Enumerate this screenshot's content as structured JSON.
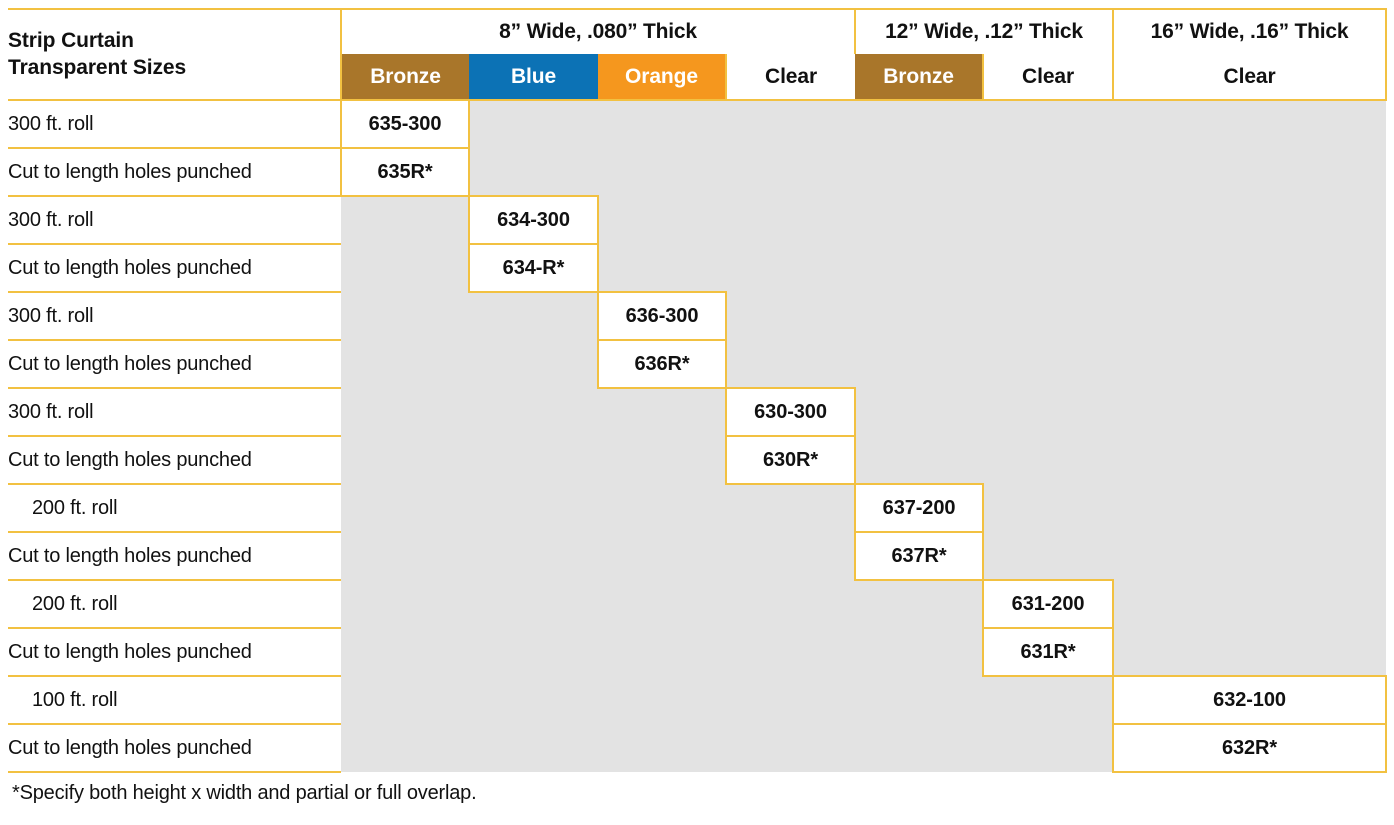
{
  "table": {
    "title_line1": "Strip Curtain",
    "title_line2": "Transparent Sizes",
    "group_headers": [
      {
        "label": "8” Wide, .080” Thick",
        "span": 4
      },
      {
        "label": "12” Wide, .12” Thick",
        "span": 2
      },
      {
        "label": "16” Wide, .16” Thick",
        "span": 1
      }
    ],
    "columns": [
      {
        "label": "Bronze",
        "swatch": "bronze",
        "color": "#A9762A",
        "text_color": "#FFFFFF"
      },
      {
        "label": "Blue",
        "swatch": "blue",
        "color": "#0C72B5",
        "text_color": "#FFFFFF"
      },
      {
        "label": "Orange",
        "swatch": "orange",
        "color": "#F5971E",
        "text_color": "#FFFFFF"
      },
      {
        "label": "Clear",
        "swatch": "clear",
        "color": "#FFFFFF",
        "text_color": "#111111"
      },
      {
        "label": "Bronze",
        "swatch": "bronze",
        "color": "#A9762A",
        "text_color": "#FFFFFF"
      },
      {
        "label": "Clear",
        "swatch": "clear",
        "color": "#FFFFFF",
        "text_color": "#111111"
      },
      {
        "label": "Clear",
        "swatch": "clear",
        "color": "#FFFFFF",
        "text_color": "#111111"
      }
    ],
    "rows": [
      {
        "label": "300 ft. roll",
        "indent": false,
        "col": 0,
        "code": "635-300"
      },
      {
        "label": "Cut to length holes punched",
        "indent": false,
        "col": 0,
        "code": "635R*"
      },
      {
        "label": "300 ft. roll",
        "indent": false,
        "col": 1,
        "code": "634-300"
      },
      {
        "label": "Cut to length holes punched",
        "indent": false,
        "col": 1,
        "code": "634-R*"
      },
      {
        "label": "300 ft. roll",
        "indent": false,
        "col": 2,
        "code": "636-300"
      },
      {
        "label": "Cut to length holes punched",
        "indent": false,
        "col": 2,
        "code": "636R*"
      },
      {
        "label": "300 ft. roll",
        "indent": false,
        "col": 3,
        "code": "630-300"
      },
      {
        "label": "Cut to length holes punched",
        "indent": false,
        "col": 3,
        "code": "630R*"
      },
      {
        "label": "200 ft. roll",
        "indent": true,
        "col": 4,
        "code": "637-200"
      },
      {
        "label": "Cut to length holes punched",
        "indent": false,
        "col": 4,
        "code": "637R*"
      },
      {
        "label": "200 ft. roll",
        "indent": true,
        "col": 5,
        "code": "631-200"
      },
      {
        "label": "Cut to length holes punched",
        "indent": false,
        "col": 5,
        "code": "631R*"
      },
      {
        "label": "100 ft. roll",
        "indent": true,
        "col": 6,
        "code": "632-100"
      },
      {
        "label": "Cut to length holes punched",
        "indent": false,
        "col": 6,
        "code": "632R*"
      }
    ],
    "footnote": "*Specify both height x width and partial or full overlap.",
    "colors": {
      "border": "#F2C141",
      "blank_fill": "#E3E3E3",
      "bronze": "#A9762A",
      "blue": "#0C72B5",
      "orange": "#F5971E",
      "text": "#111111"
    }
  }
}
